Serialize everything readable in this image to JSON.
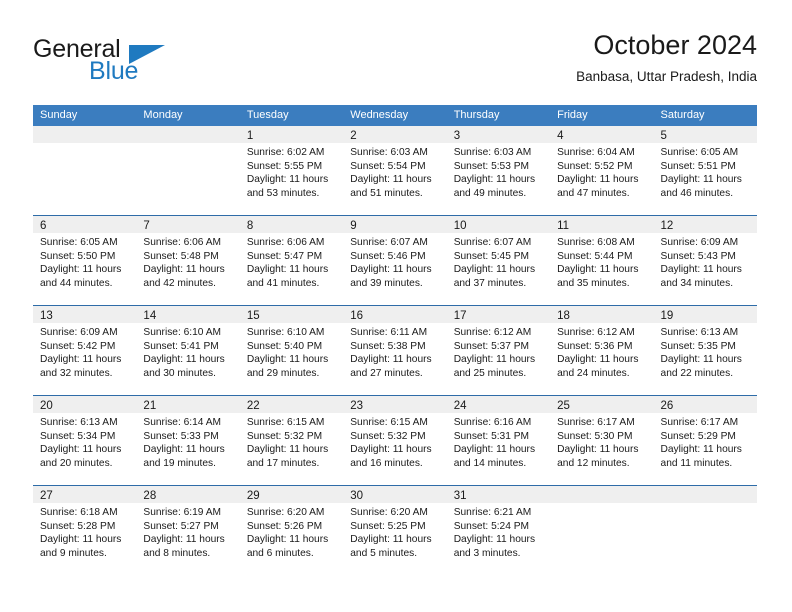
{
  "brand": {
    "word1": "General",
    "word2": "Blue",
    "accent_color": "#1f7ac0",
    "logo_name": "general-blue-logo"
  },
  "header": {
    "title": "October 2024",
    "subtitle": "Banbasa, Uttar Pradesh, India"
  },
  "colors": {
    "header_blue": "#3b7dbf",
    "row_divider_blue": "#2e6ca8",
    "date_band_gray": "#efefef",
    "text": "#1a1a1a"
  },
  "calendar": {
    "day_headers": [
      "Sunday",
      "Monday",
      "Tuesday",
      "Wednesday",
      "Thursday",
      "Friday",
      "Saturday"
    ],
    "weeks": [
      [
        {
          "day": "",
          "sunrise": "",
          "sunset": "",
          "daylight1": "",
          "daylight2": ""
        },
        {
          "day": "",
          "sunrise": "",
          "sunset": "",
          "daylight1": "",
          "daylight2": ""
        },
        {
          "day": "1",
          "sunrise": "Sunrise: 6:02 AM",
          "sunset": "Sunset: 5:55 PM",
          "daylight1": "Daylight: 11 hours",
          "daylight2": "and 53 minutes."
        },
        {
          "day": "2",
          "sunrise": "Sunrise: 6:03 AM",
          "sunset": "Sunset: 5:54 PM",
          "daylight1": "Daylight: 11 hours",
          "daylight2": "and 51 minutes."
        },
        {
          "day": "3",
          "sunrise": "Sunrise: 6:03 AM",
          "sunset": "Sunset: 5:53 PM",
          "daylight1": "Daylight: 11 hours",
          "daylight2": "and 49 minutes."
        },
        {
          "day": "4",
          "sunrise": "Sunrise: 6:04 AM",
          "sunset": "Sunset: 5:52 PM",
          "daylight1": "Daylight: 11 hours",
          "daylight2": "and 47 minutes."
        },
        {
          "day": "5",
          "sunrise": "Sunrise: 6:05 AM",
          "sunset": "Sunset: 5:51 PM",
          "daylight1": "Daylight: 11 hours",
          "daylight2": "and 46 minutes."
        }
      ],
      [
        {
          "day": "6",
          "sunrise": "Sunrise: 6:05 AM",
          "sunset": "Sunset: 5:50 PM",
          "daylight1": "Daylight: 11 hours",
          "daylight2": "and 44 minutes."
        },
        {
          "day": "7",
          "sunrise": "Sunrise: 6:06 AM",
          "sunset": "Sunset: 5:48 PM",
          "daylight1": "Daylight: 11 hours",
          "daylight2": "and 42 minutes."
        },
        {
          "day": "8",
          "sunrise": "Sunrise: 6:06 AM",
          "sunset": "Sunset: 5:47 PM",
          "daylight1": "Daylight: 11 hours",
          "daylight2": "and 41 minutes."
        },
        {
          "day": "9",
          "sunrise": "Sunrise: 6:07 AM",
          "sunset": "Sunset: 5:46 PM",
          "daylight1": "Daylight: 11 hours",
          "daylight2": "and 39 minutes."
        },
        {
          "day": "10",
          "sunrise": "Sunrise: 6:07 AM",
          "sunset": "Sunset: 5:45 PM",
          "daylight1": "Daylight: 11 hours",
          "daylight2": "and 37 minutes."
        },
        {
          "day": "11",
          "sunrise": "Sunrise: 6:08 AM",
          "sunset": "Sunset: 5:44 PM",
          "daylight1": "Daylight: 11 hours",
          "daylight2": "and 35 minutes."
        },
        {
          "day": "12",
          "sunrise": "Sunrise: 6:09 AM",
          "sunset": "Sunset: 5:43 PM",
          "daylight1": "Daylight: 11 hours",
          "daylight2": "and 34 minutes."
        }
      ],
      [
        {
          "day": "13",
          "sunrise": "Sunrise: 6:09 AM",
          "sunset": "Sunset: 5:42 PM",
          "daylight1": "Daylight: 11 hours",
          "daylight2": "and 32 minutes."
        },
        {
          "day": "14",
          "sunrise": "Sunrise: 6:10 AM",
          "sunset": "Sunset: 5:41 PM",
          "daylight1": "Daylight: 11 hours",
          "daylight2": "and 30 minutes."
        },
        {
          "day": "15",
          "sunrise": "Sunrise: 6:10 AM",
          "sunset": "Sunset: 5:40 PM",
          "daylight1": "Daylight: 11 hours",
          "daylight2": "and 29 minutes."
        },
        {
          "day": "16",
          "sunrise": "Sunrise: 6:11 AM",
          "sunset": "Sunset: 5:38 PM",
          "daylight1": "Daylight: 11 hours",
          "daylight2": "and 27 minutes."
        },
        {
          "day": "17",
          "sunrise": "Sunrise: 6:12 AM",
          "sunset": "Sunset: 5:37 PM",
          "daylight1": "Daylight: 11 hours",
          "daylight2": "and 25 minutes."
        },
        {
          "day": "18",
          "sunrise": "Sunrise: 6:12 AM",
          "sunset": "Sunset: 5:36 PM",
          "daylight1": "Daylight: 11 hours",
          "daylight2": "and 24 minutes."
        },
        {
          "day": "19",
          "sunrise": "Sunrise: 6:13 AM",
          "sunset": "Sunset: 5:35 PM",
          "daylight1": "Daylight: 11 hours",
          "daylight2": "and 22 minutes."
        }
      ],
      [
        {
          "day": "20",
          "sunrise": "Sunrise: 6:13 AM",
          "sunset": "Sunset: 5:34 PM",
          "daylight1": "Daylight: 11 hours",
          "daylight2": "and 20 minutes."
        },
        {
          "day": "21",
          "sunrise": "Sunrise: 6:14 AM",
          "sunset": "Sunset: 5:33 PM",
          "daylight1": "Daylight: 11 hours",
          "daylight2": "and 19 minutes."
        },
        {
          "day": "22",
          "sunrise": "Sunrise: 6:15 AM",
          "sunset": "Sunset: 5:32 PM",
          "daylight1": "Daylight: 11 hours",
          "daylight2": "and 17 minutes."
        },
        {
          "day": "23",
          "sunrise": "Sunrise: 6:15 AM",
          "sunset": "Sunset: 5:32 PM",
          "daylight1": "Daylight: 11 hours",
          "daylight2": "and 16 minutes."
        },
        {
          "day": "24",
          "sunrise": "Sunrise: 6:16 AM",
          "sunset": "Sunset: 5:31 PM",
          "daylight1": "Daylight: 11 hours",
          "daylight2": "and 14 minutes."
        },
        {
          "day": "25",
          "sunrise": "Sunrise: 6:17 AM",
          "sunset": "Sunset: 5:30 PM",
          "daylight1": "Daylight: 11 hours",
          "daylight2": "and 12 minutes."
        },
        {
          "day": "26",
          "sunrise": "Sunrise: 6:17 AM",
          "sunset": "Sunset: 5:29 PM",
          "daylight1": "Daylight: 11 hours",
          "daylight2": "and 11 minutes."
        }
      ],
      [
        {
          "day": "27",
          "sunrise": "Sunrise: 6:18 AM",
          "sunset": "Sunset: 5:28 PM",
          "daylight1": "Daylight: 11 hours",
          "daylight2": "and 9 minutes."
        },
        {
          "day": "28",
          "sunrise": "Sunrise: 6:19 AM",
          "sunset": "Sunset: 5:27 PM",
          "daylight1": "Daylight: 11 hours",
          "daylight2": "and 8 minutes."
        },
        {
          "day": "29",
          "sunrise": "Sunrise: 6:20 AM",
          "sunset": "Sunset: 5:26 PM",
          "daylight1": "Daylight: 11 hours",
          "daylight2": "and 6 minutes."
        },
        {
          "day": "30",
          "sunrise": "Sunrise: 6:20 AM",
          "sunset": "Sunset: 5:25 PM",
          "daylight1": "Daylight: 11 hours",
          "daylight2": "and 5 minutes."
        },
        {
          "day": "31",
          "sunrise": "Sunrise: 6:21 AM",
          "sunset": "Sunset: 5:24 PM",
          "daylight1": "Daylight: 11 hours",
          "daylight2": "and 3 minutes."
        },
        {
          "day": "",
          "sunrise": "",
          "sunset": "",
          "daylight1": "",
          "daylight2": ""
        },
        {
          "day": "",
          "sunrise": "",
          "sunset": "",
          "daylight1": "",
          "daylight2": ""
        }
      ]
    ]
  }
}
